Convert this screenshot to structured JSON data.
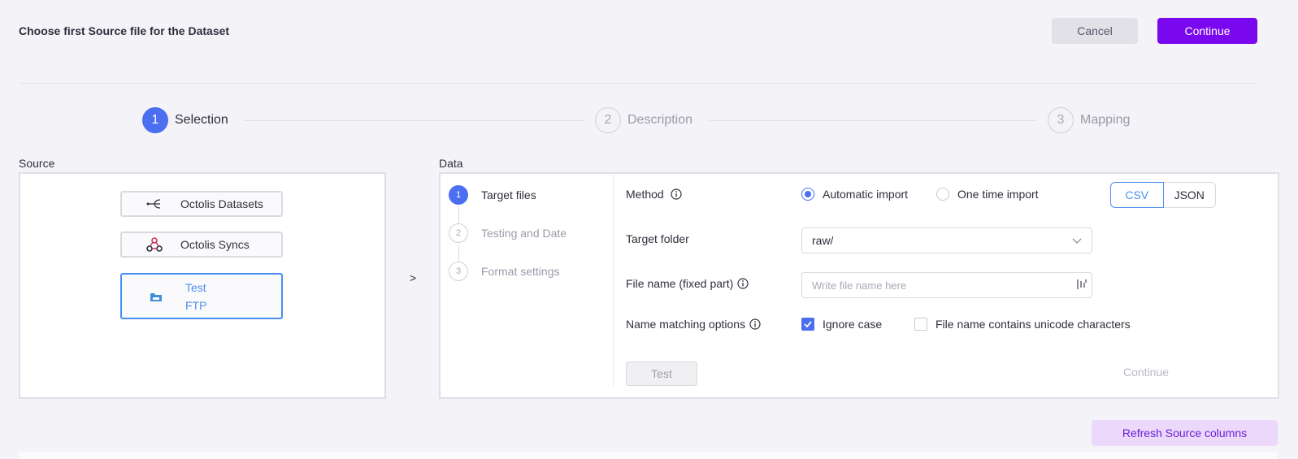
{
  "header": {
    "title": "Choose first Source file for the Dataset",
    "cancel_label": "Cancel",
    "continue_label": "Continue"
  },
  "stepper": [
    {
      "number": "1",
      "label": "Selection",
      "active": true
    },
    {
      "number": "2",
      "label": "Description",
      "active": false
    },
    {
      "number": "3",
      "label": "Mapping",
      "active": false
    }
  ],
  "source": {
    "label": "Source",
    "items": [
      {
        "label": "Octolis Datasets",
        "icon": "dataset-fork-icon"
      },
      {
        "label": "Octolis Syncs",
        "icon": "webhook-icon"
      },
      {
        "label_line1": "Test",
        "label_line2": "FTP",
        "icon": "ftp-folder-icon",
        "selected": true
      }
    ]
  },
  "arrow": ">",
  "data": {
    "label": "Data",
    "substeps": [
      {
        "number": "1",
        "label": "Target files",
        "active": true
      },
      {
        "number": "2",
        "label": "Testing and Date",
        "active": false
      },
      {
        "number": "3",
        "label": "Format settings",
        "active": false
      }
    ],
    "method": {
      "label": "Method",
      "options": [
        "Automatic import",
        "One time import"
      ],
      "selected": "Automatic import",
      "formats": [
        "CSV",
        "JSON"
      ],
      "selected_format": "CSV"
    },
    "target_folder": {
      "label": "Target folder",
      "value": "raw/"
    },
    "file_name": {
      "label": "File name (fixed part)",
      "placeholder": "Write file name here"
    },
    "name_matching": {
      "label": "Name matching options",
      "ignore_case": {
        "label": "Ignore case",
        "checked": true
      },
      "unicode": {
        "label": "File name contains unicode characters",
        "checked": false
      }
    },
    "test_label": "Test",
    "continue_label": "Continue"
  },
  "refresh_label": "Refresh Source columns",
  "colors": {
    "accent": "#7a08ee",
    "step_active": "#4b6ff0",
    "selected_border": "#4b8ff0"
  }
}
